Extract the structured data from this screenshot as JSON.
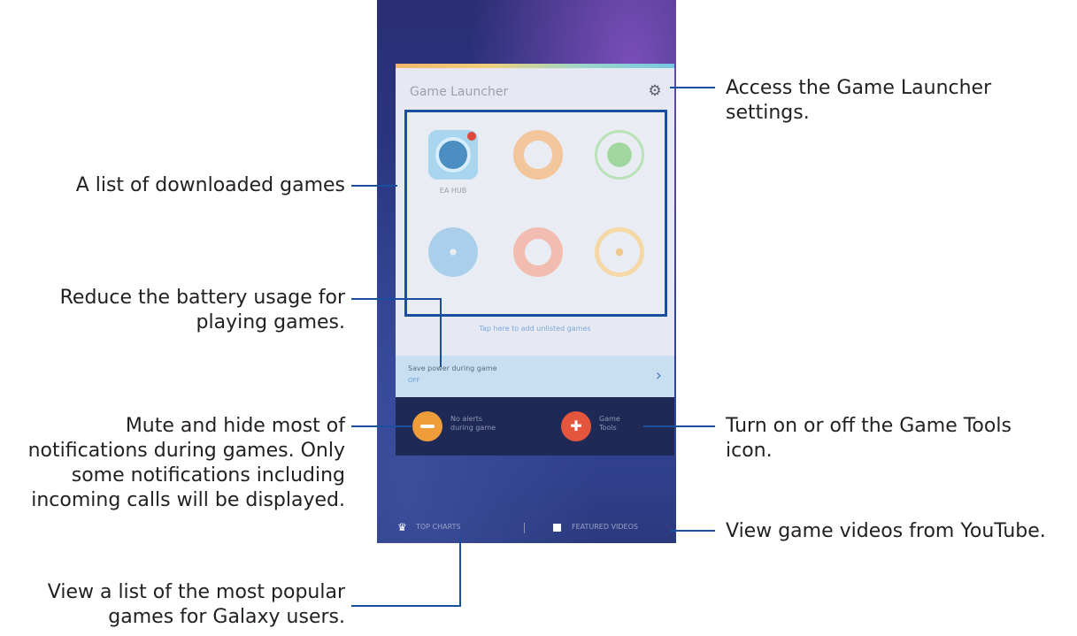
{
  "callouts": {
    "settings": [
      "Access the Game Launcher",
      "settings."
    ],
    "games_list": "A list of downloaded games",
    "battery": [
      "Reduce the battery usage for",
      "playing games."
    ],
    "mute": [
      "Mute and hide most of",
      "notifications during games. Only",
      "some notifications including",
      "incoming calls will be displayed."
    ],
    "game_tools": [
      "Turn on or off the Game Tools",
      "icon."
    ],
    "videos": "View game videos from YouTube.",
    "top_charts": [
      "View a list of the most popular",
      "games for Galaxy users."
    ]
  },
  "app": {
    "title": "Game Launcher",
    "games": [
      {
        "label": "EA HUB",
        "icon": "ea-hub-icon"
      }
    ],
    "add_link": "Tap here to add unlisted games",
    "save_power": {
      "title": "Save power during game",
      "status": "OFF"
    },
    "toolbar": {
      "mute_label": [
        "No alerts",
        "during game"
      ],
      "tools_label": [
        "Game",
        "Tools"
      ]
    },
    "bottom_nav": {
      "top_charts": "TOP CHARTS",
      "featured_videos": "FEATURED VIDEOS"
    }
  },
  "colors": {
    "callout_line": "#1a4fa0",
    "toolbar": "#1e2a55",
    "mute_button": "#ee9d3a",
    "tools_button": "#e4553e"
  }
}
